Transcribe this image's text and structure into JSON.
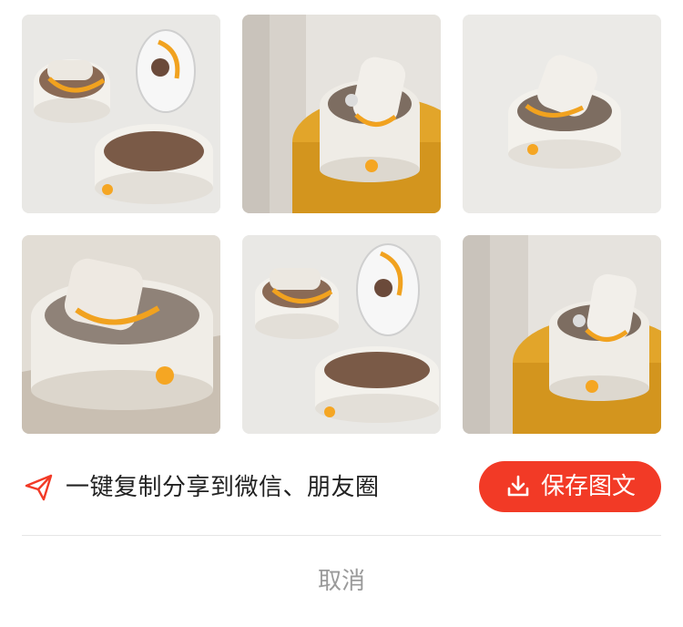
{
  "images": [
    {
      "icon": "product-photo-open-lid"
    },
    {
      "icon": "product-photo-on-yellow-stand"
    },
    {
      "icon": "product-photo-floating"
    },
    {
      "icon": "product-photo-closeup"
    },
    {
      "icon": "product-photo-open-lid"
    },
    {
      "icon": "product-photo-on-yellow-stand"
    }
  ],
  "share": {
    "icon": "paper-plane-icon",
    "text": "一键复制分享到微信、朋友圈"
  },
  "save_button": {
    "icon": "download-icon",
    "label": "保存图文"
  },
  "cancel_label": "取消",
  "colors": {
    "accent": "#f23a26",
    "product_orange": "#f5a623",
    "stand_yellow": "#e2a52a"
  }
}
